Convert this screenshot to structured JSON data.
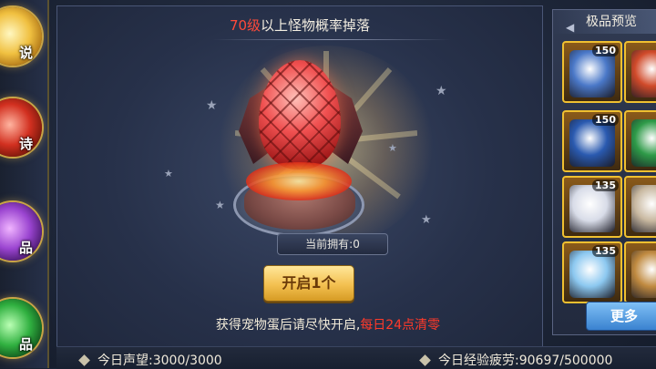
{
  "sidebar": {
    "items": [
      {
        "label": "说"
      },
      {
        "label": "诗"
      },
      {
        "label": "品"
      },
      {
        "label": "品"
      }
    ]
  },
  "main": {
    "drop_level": "70级",
    "drop_text": "以上怪物概率掉落",
    "owned_label": "当前拥有:0",
    "open_button": "开启1个",
    "hint_main": "获得宠物蛋后请尽快开启,",
    "hint_red": "每日24点清零"
  },
  "stats": {
    "reputation_label": "今日声望:",
    "reputation_value": "3000/3000",
    "exp_label": "今日经验疲劳:",
    "exp_value": "90697/500000"
  },
  "preview": {
    "title": "极品预览",
    "cards": [
      {
        "level": "150",
        "color": "#4a78c8"
      },
      {
        "level": "",
        "color": "#d04a2a"
      },
      {
        "level": "150",
        "color": "#2a5ab0"
      },
      {
        "level": "",
        "color": "#2e9a48"
      },
      {
        "level": "135",
        "color": "#d8dce8"
      },
      {
        "level": "",
        "color": "#c8b8a0"
      },
      {
        "level": "135",
        "color": "#8cc8f0"
      },
      {
        "level": "",
        "color": "#c08a40"
      }
    ],
    "more_button": "更多"
  }
}
